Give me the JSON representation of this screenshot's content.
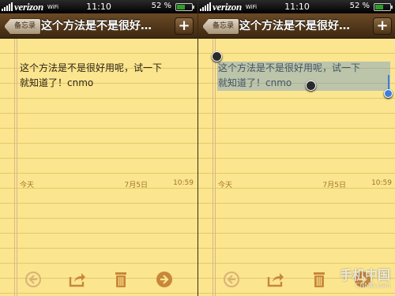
{
  "screens": [
    {
      "status": {
        "carrier": "verizon",
        "wifi": "WiFi",
        "time": "11:10",
        "battery": "52 %",
        "battery_level": 0.52
      },
      "nav": {
        "back_label": "备忘录",
        "title": "这个方法是不是很好…",
        "add_label": "+"
      },
      "note": {
        "lines": [
          "这个方法是不是很好用呢，试一下",
          "就知道了！cnmo"
        ],
        "date_label": "今天",
        "date": "7月5日",
        "time": "10:59"
      }
    },
    {
      "status": {
        "carrier": "verizon",
        "wifi": "WiFi",
        "time": "11:10",
        "battery": "52 %",
        "battery_level": 0.52
      },
      "nav": {
        "back_label": "备忘录",
        "title": "这个方法是不是很好…",
        "add_label": "+"
      },
      "note": {
        "lines": [
          "这个方法是不是很好用呢，试一下",
          "就知道了！cnmo"
        ],
        "date_label": "今天",
        "date": "7月5日",
        "time": "10:59"
      },
      "selection_active": true
    }
  ],
  "watermark": {
    "text": "手机中国",
    "sub": "CNMO.com"
  },
  "colors": {
    "paper": "#fbe58e",
    "nav": "#5a3c1c",
    "icon": "#c8873a",
    "selection": "#6496d2"
  }
}
